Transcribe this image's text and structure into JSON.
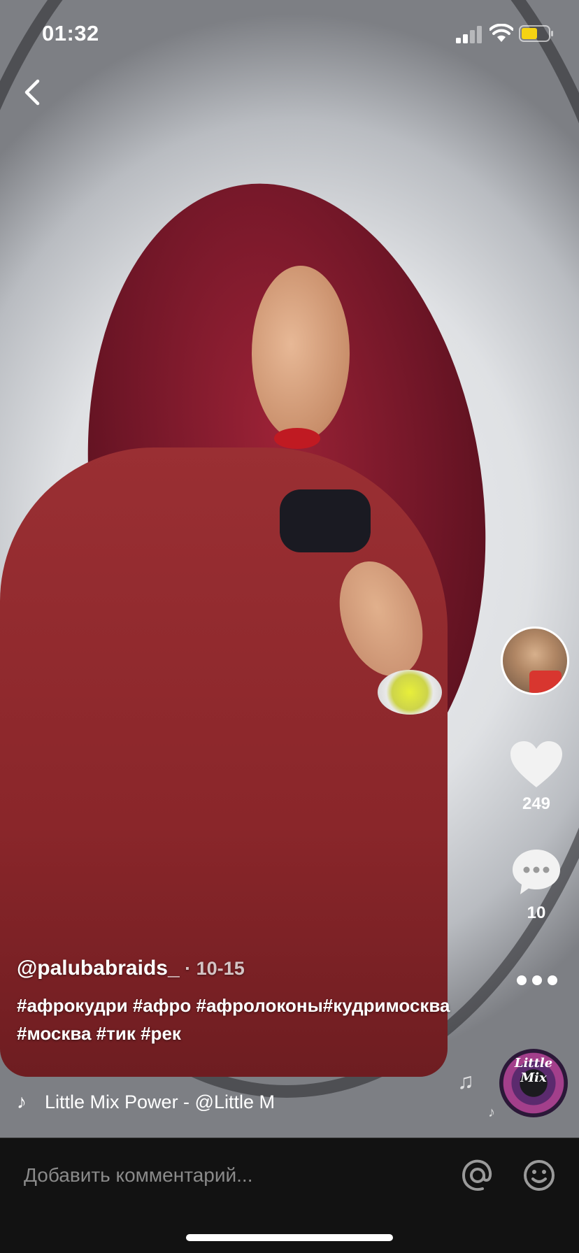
{
  "status_bar": {
    "time": "01:32"
  },
  "video": {
    "description_colors": {
      "hair": "#7a1a2b",
      "sweater": "#8e2a2e",
      "backdrop": "#e3e5e8"
    }
  },
  "rail": {
    "like_count": "249",
    "comment_count": "10"
  },
  "caption": {
    "author": "@palubabraids_",
    "date": " · 10-15",
    "hashtags": "#афрокудри #афро #афролоконы#кудримосква #москва #тик #рек",
    "sound": "Little Mix    Power - @Little M"
  },
  "music_disc": {
    "label": "Little Mix"
  },
  "comment_bar": {
    "placeholder": "Добавить комментарий..."
  },
  "colors": {
    "accent_battery": "#f5d313",
    "comment_bar_bg": "#121212"
  },
  "icons": [
    "back-icon",
    "signal-icon",
    "wifi-icon",
    "battery-icon",
    "heart-icon",
    "comment-icon",
    "more-icon",
    "music-note-icon",
    "at-icon",
    "emoji-icon"
  ]
}
